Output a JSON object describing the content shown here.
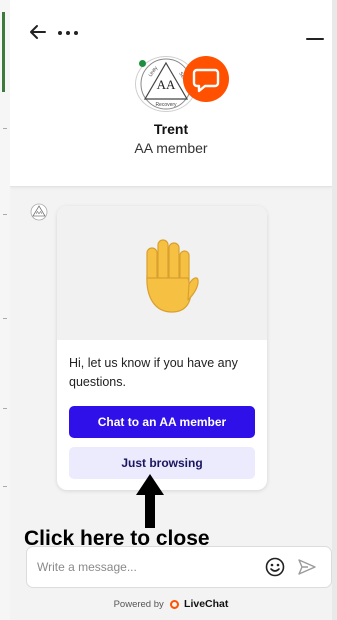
{
  "header": {
    "agent_name": "Trent",
    "agent_role": "AA member",
    "avatar_text": "AA",
    "avatar_seal_words": [
      "Unity",
      "Service",
      "Recovery"
    ],
    "online_color": "#1e8e3e",
    "brand_color": "#ff5100"
  },
  "icons": {
    "back": "back-arrow-icon",
    "more": "more-dots-icon",
    "minimize": "minimize-icon",
    "hand": "raised-hand-icon",
    "emoji": "emoji-icon",
    "send": "send-icon"
  },
  "message_card": {
    "text": "Hi, let us know if you have any questions.",
    "primary_button": "Chat to an AA member",
    "secondary_button": "Just browsing",
    "primary_color": "#2f10e8"
  },
  "annotation": {
    "text": "Click here to close"
  },
  "composer": {
    "placeholder": "Write a message..."
  },
  "footer": {
    "powered_by": "Powered by",
    "brand": "LiveChat"
  }
}
